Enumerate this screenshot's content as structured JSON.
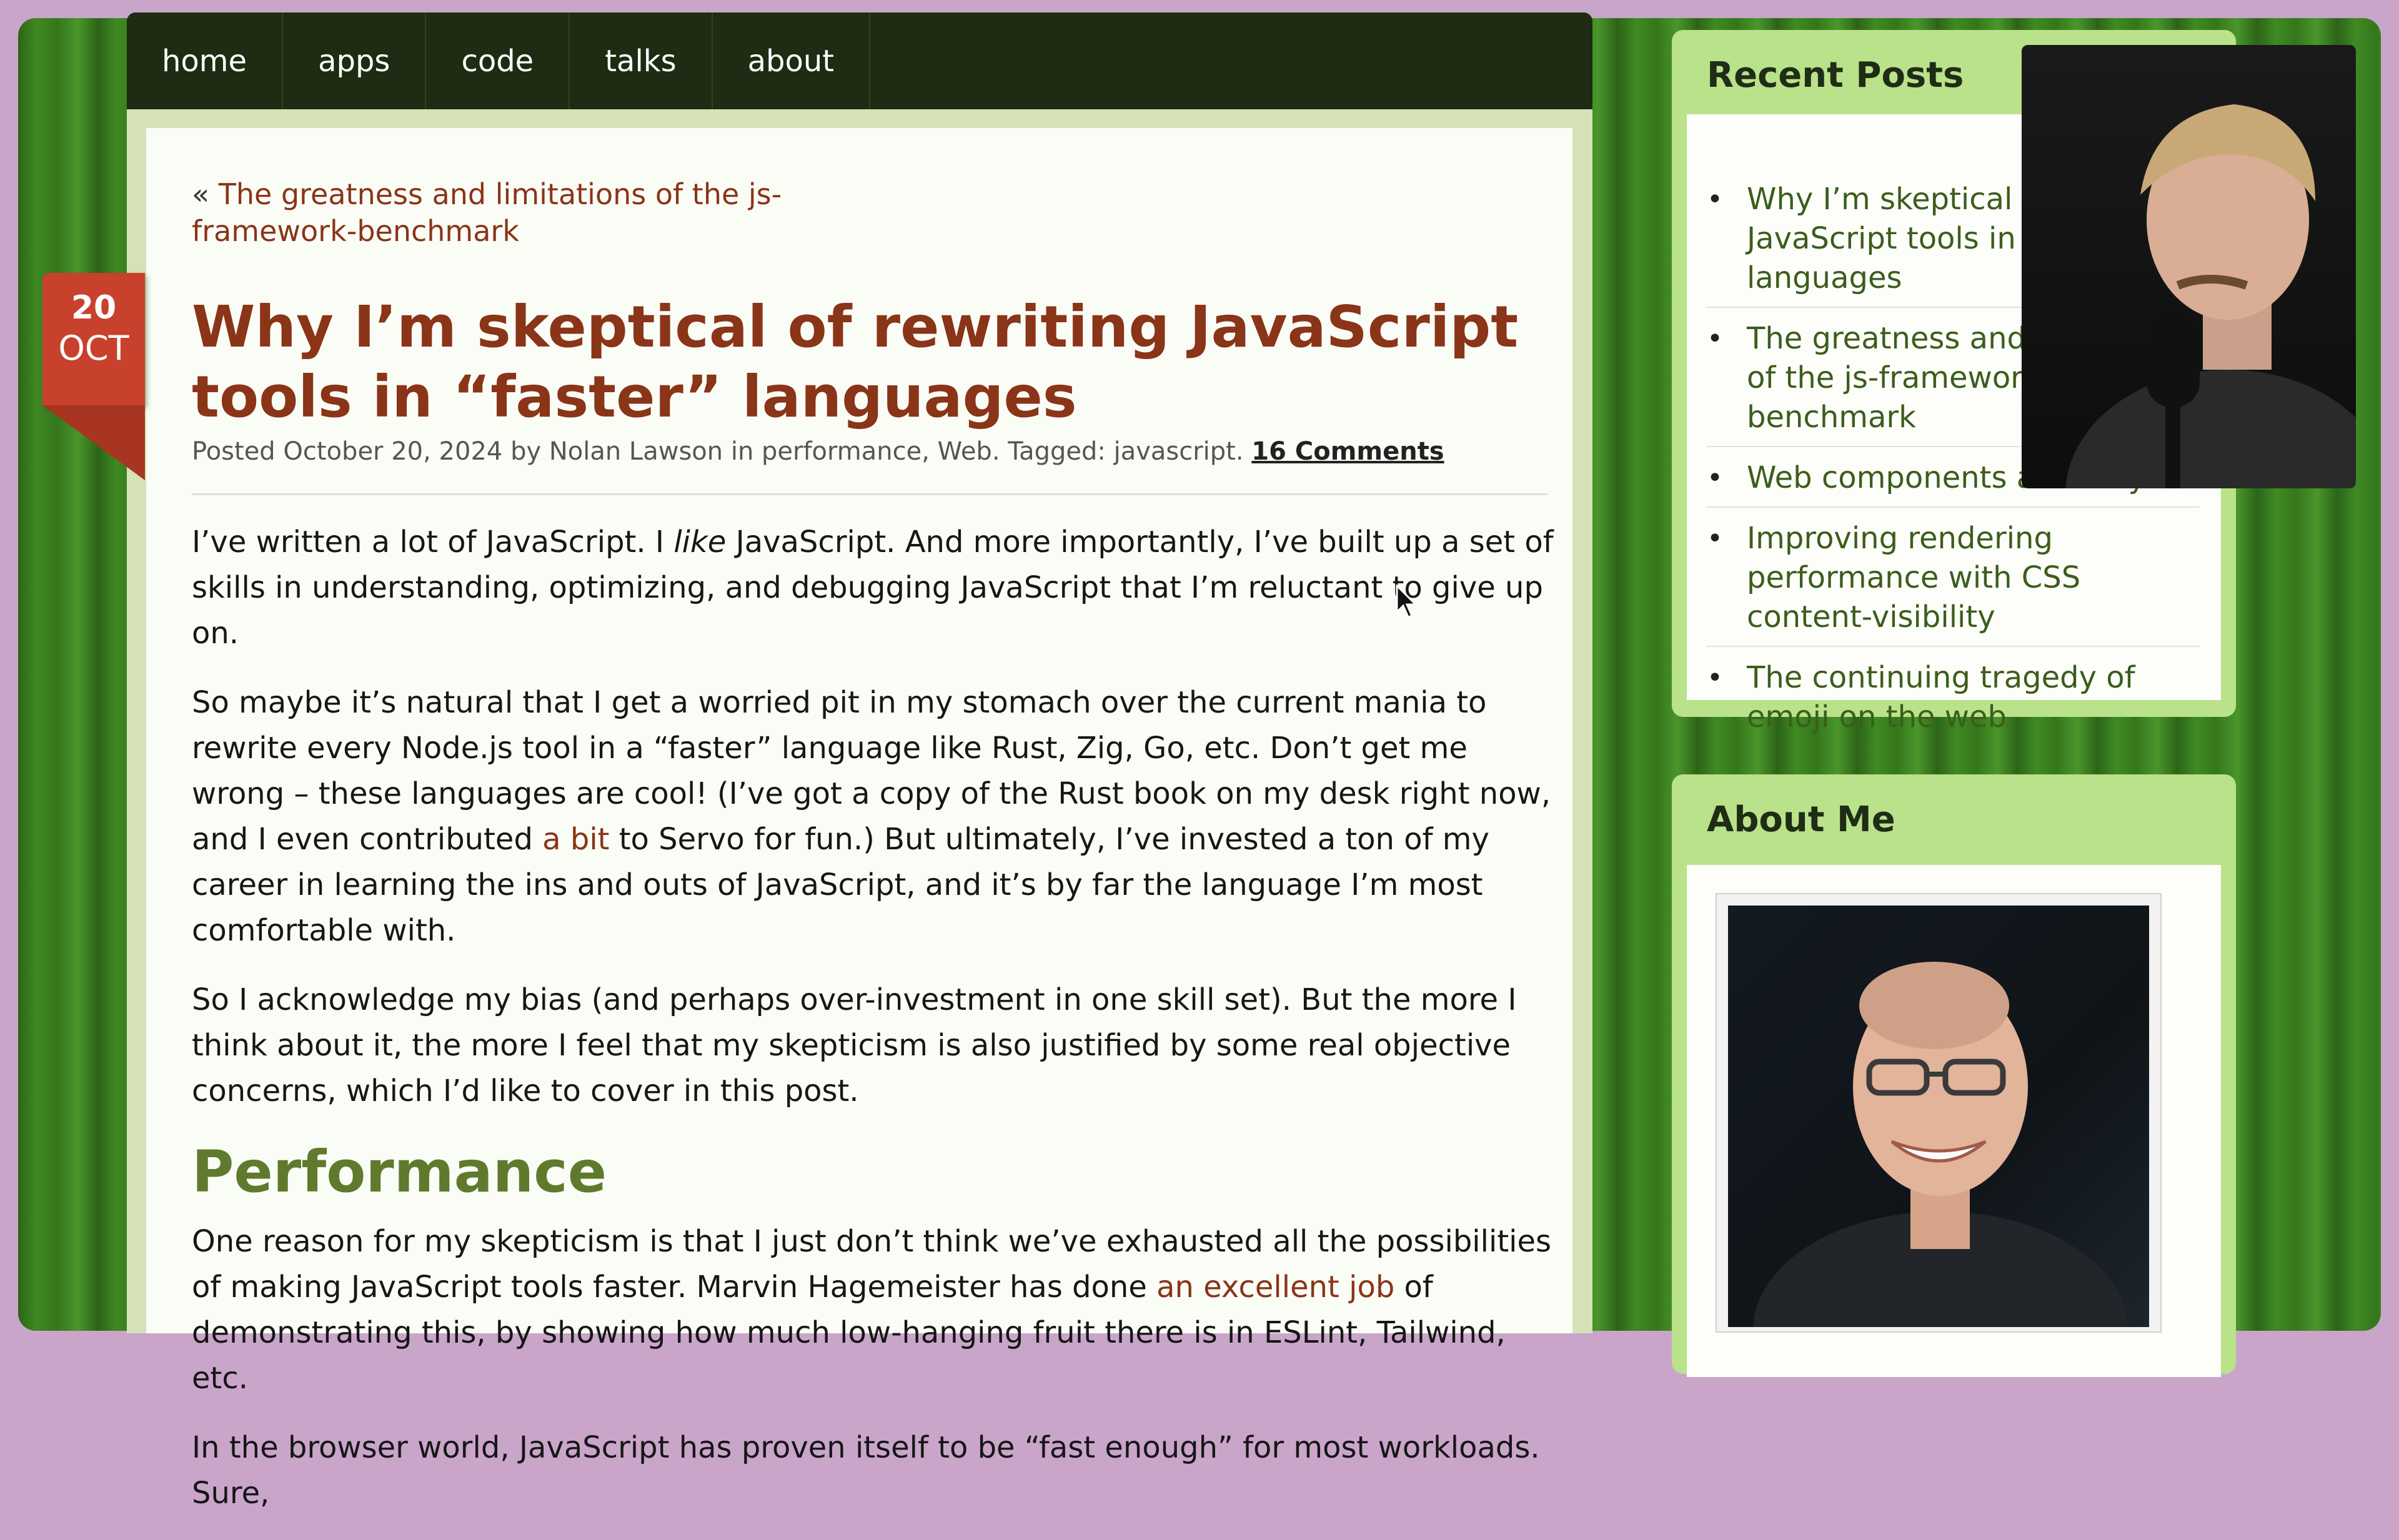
{
  "nav": {
    "items": [
      {
        "label": "home"
      },
      {
        "label": "apps"
      },
      {
        "label": "code"
      },
      {
        "label": "talks"
      },
      {
        "label": "about"
      }
    ]
  },
  "post": {
    "prev_prefix": "«",
    "prev_title": "The greatness and limitations of the js-framework-benchmark",
    "date_day": "20",
    "date_month": "OCT",
    "title": "Why I’m skeptical of rewriting JavaScript tools in “faster” languages",
    "meta": {
      "posted_prefix": "Posted",
      "date": "October 20, 2024",
      "by": "by",
      "author": "Nolan Lawson",
      "in": "in",
      "categories": "performance, Web.",
      "tagged_prefix": "Tagged:",
      "tag": "javascript.",
      "comments": "16 Comments"
    },
    "p1": {
      "before": "I’ve written a lot of JavaScript. I ",
      "em": "like",
      "after": " JavaScript. And more importantly, I’ve built up a set of skills in understanding, optimizing, and debugging JavaScript that I’m reluctant to give up on."
    },
    "p2": {
      "before": "So maybe it’s natural that I get a worried pit in my stomach over the current mania to rewrite every Node.js tool in a “faster” language like Rust, Zig, Go, etc. Don’t get me wrong – these languages are cool! (I’ve got a copy of the Rust book on my desk right now, and I even contributed ",
      "link": "a bit",
      "after": " to Servo for fun.) But ultimately, I’ve invested a ton of my career in learning the ins and outs of JavaScript, and it’s by far the language I’m most comfortable with."
    },
    "p3": "So I acknowledge my bias (and perhaps over-investment in one skill set). But the more I think about it, the more I feel that my skepticism is also justified by some real objective concerns, which I’d like to cover in this post.",
    "h2": "Performance",
    "p4": {
      "before": "One reason for my skepticism is that I just don’t think we’ve exhausted all the possibilities of making JavaScript tools faster. Marvin Hagemeister has done ",
      "link": "an excellent job",
      "after": " of demonstrating this, by showing how much low-hanging fruit there is in ESLint, Tailwind, etc."
    },
    "p5": "In the browser world, JavaScript has proven itself to be “fast enough” for most workloads. Sure,"
  },
  "sidebar": {
    "recent_title": "Recent Posts",
    "recent_posts": [
      {
        "label": "Why I’m skeptical of rewriting JavaScript tools in “faster” languages"
      },
      {
        "label": "The greatness and limitations of the js-framework-benchmark"
      },
      {
        "label": "Web components are okay"
      },
      {
        "label": "Improving rendering performance with CSS content-visibility"
      },
      {
        "label": "The continuing tragedy of emoji on the web"
      }
    ],
    "about_title": "About Me"
  },
  "colors": {
    "title": "#8a3418",
    "heading": "#5f7a2c",
    "sidebar_link": "#3c5d1c",
    "badge": "#c8412c",
    "nav_bg": "#1d2c12"
  }
}
